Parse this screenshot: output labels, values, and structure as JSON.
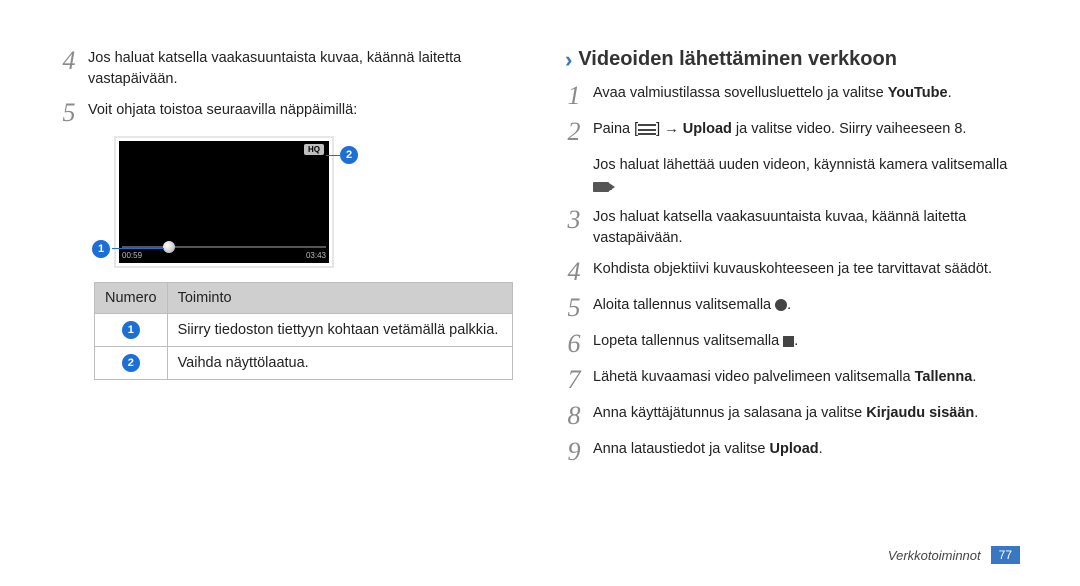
{
  "left": {
    "step4": "Jos haluat katsella vaakasuuntaista kuvaa, käännä laitetta vastapäivään.",
    "step5": "Voit ohjata toistoa seuraavilla näppäimillä:"
  },
  "video": {
    "hq": "HQ",
    "time_elapsed": "00:59",
    "time_total": "03:43"
  },
  "table": {
    "head_num": "Numero",
    "head_func": "Toiminto",
    "row1_func": "Siirry tiedoston tiettyyn kohtaan vetämällä palkkia.",
    "row2_func": "Vaihda näyttölaatua."
  },
  "right": {
    "section_title": "Videoiden lähettäminen verkkoon",
    "s1_a": "Avaa valmiustilassa sovellusluettelo ja valitse ",
    "s1_b": "YouTube",
    "s1_c": ".",
    "s2_a": "Paina [",
    "s2_b": "] → ",
    "s2_c": "Upload",
    "s2_d": " ja valitse video. Siirry vaiheeseen 8.",
    "s2_sub": "Jos haluat lähettää uuden videon, käynnistä kamera valitsemalla ",
    "s3": "Jos haluat katsella vaakasuuntaista kuvaa, käännä laitetta vastapäivään.",
    "s4": "Kohdista objektiivi kuvauskohteeseen ja tee tarvittavat säädöt.",
    "s5": "Aloita tallennus valitsemalla ",
    "s6": "Lopeta tallennus valitsemalla ",
    "s7_a": "Lähetä kuvaamasi video palvelimeen valitsemalla ",
    "s7_b": "Tallenna",
    "s7_c": ".",
    "s8_a": "Anna käyttäjätunnus ja salasana ja valitse ",
    "s8_b": "Kirjaudu sisään",
    "s8_c": ".",
    "s9_a": "Anna lataustiedot ja valitse ",
    "s9_b": "Upload",
    "s9_c": "."
  },
  "numbers": {
    "n1": "1",
    "n2": "2",
    "n3": "3",
    "n4": "4",
    "n5": "5",
    "n6": "6",
    "n7": "7",
    "n8": "8",
    "n9": "9"
  },
  "footer": {
    "section": "Verkkotoiminnot",
    "page": "77"
  }
}
